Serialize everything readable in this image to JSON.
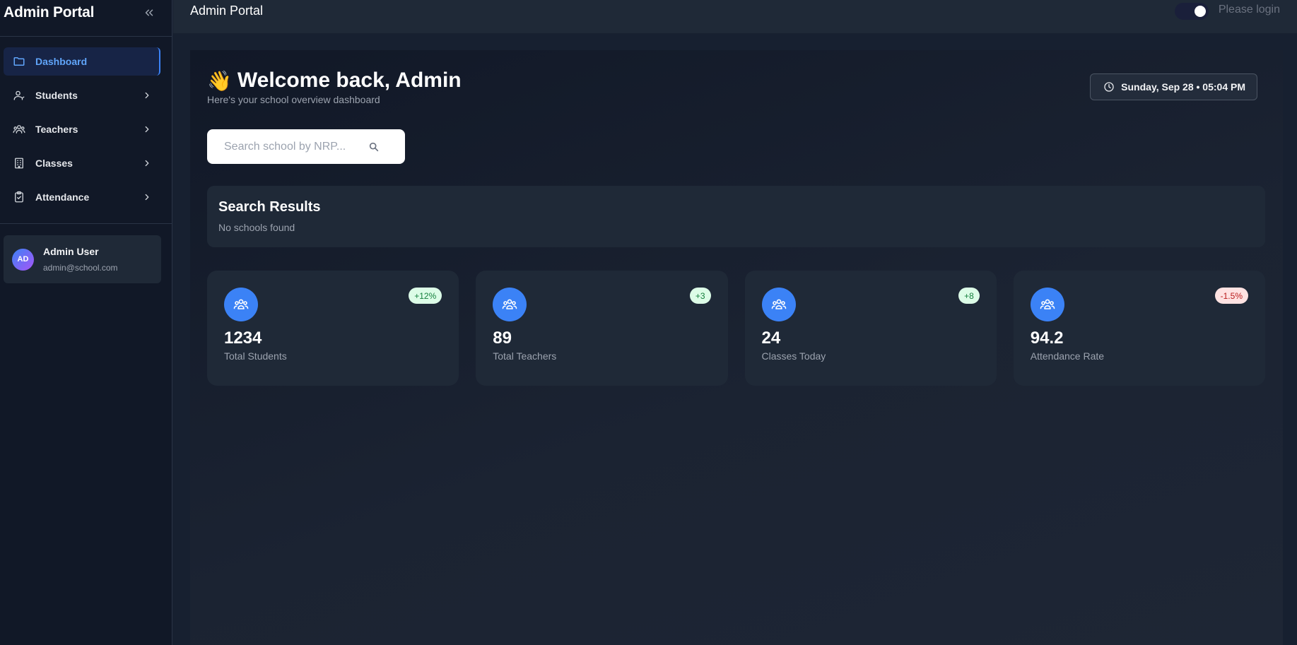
{
  "sidebar": {
    "title": "Admin Portal",
    "items": [
      {
        "label": "Dashboard",
        "icon": "folder-icon"
      },
      {
        "label": "Students",
        "icon": "students-icon"
      },
      {
        "label": "Teachers",
        "icon": "teachers-icon"
      },
      {
        "label": "Classes",
        "icon": "building-icon"
      },
      {
        "label": "Attendance",
        "icon": "clipboard-check-icon"
      }
    ],
    "user": {
      "initials": "AD",
      "name": "Admin User",
      "email": "admin@school.com"
    }
  },
  "topbar": {
    "title": "Admin Portal",
    "login_text": "Please login"
  },
  "main": {
    "wave": "👋",
    "welcome_title": "Welcome back, Admin",
    "welcome_sub": "Here's your school overview dashboard",
    "datetime": "Sunday, Sep 28 • 05:04 PM",
    "search": {
      "placeholder": "Search school by NRP..."
    },
    "results": {
      "title": "Search Results",
      "empty_text": "No schools found"
    },
    "stats": [
      {
        "value": "1234",
        "label": "Total Students",
        "badge": "+12%",
        "trend": "up"
      },
      {
        "value": "89",
        "label": "Total Teachers",
        "badge": "+3",
        "trend": "up"
      },
      {
        "value": "24",
        "label": "Classes Today",
        "badge": "+8",
        "trend": "up"
      },
      {
        "value": "94.2",
        "label": "Attendance Rate",
        "badge": "-1.5%",
        "trend": "down"
      }
    ]
  },
  "colors": {
    "accent": "#3b82f6",
    "sidebar_bg": "#111827",
    "card_bg": "#1f2937",
    "badge_up_bg": "#dcfce7",
    "badge_down_bg": "#fee2e2"
  }
}
